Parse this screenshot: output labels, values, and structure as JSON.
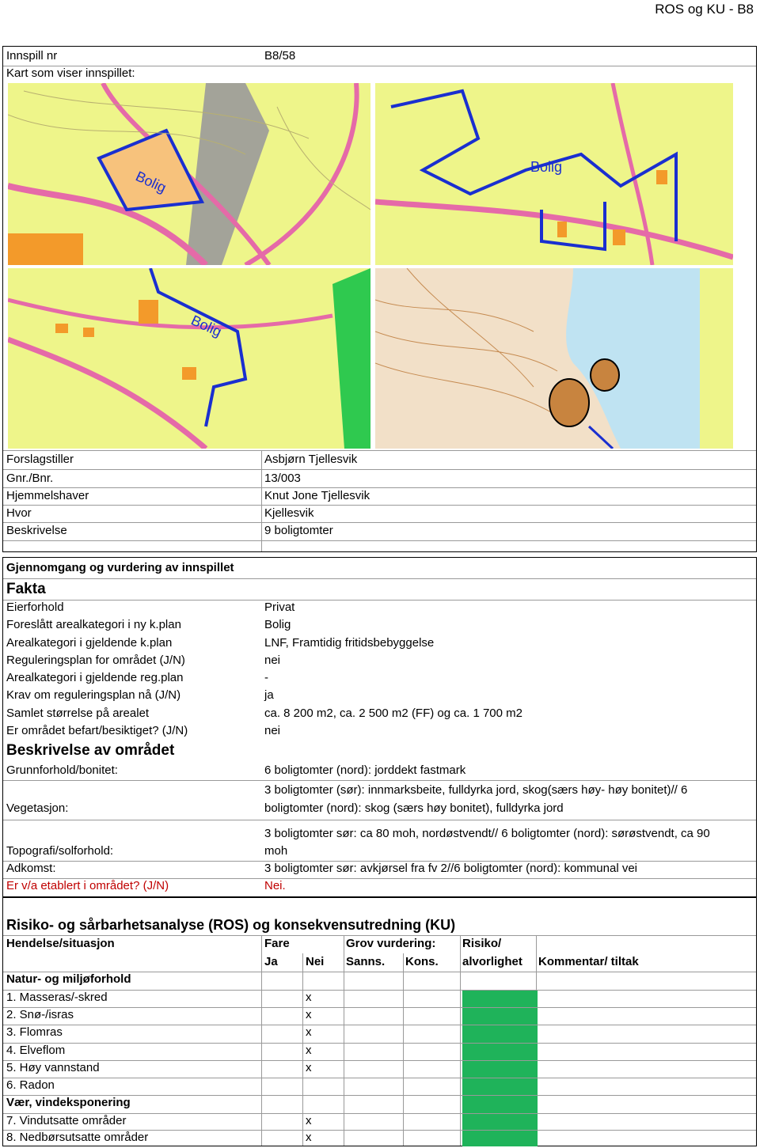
{
  "header": {
    "title": "ROS og KU - B8"
  },
  "top": {
    "innspill_label": "Innspill nr",
    "innspill_value": "B8/58",
    "map_label": "Kart som viser innspillet:"
  },
  "maps": {
    "label": "Bolig"
  },
  "info": [
    {
      "label": "Forslagstiller",
      "value": "Asbjørn Tjellesvik"
    },
    {
      "label": "Gnr./Bnr.",
      "value": "13/003"
    },
    {
      "label": "Hjemmelshaver",
      "value": "Knut Jone Tjellesvik"
    },
    {
      "label": "Hvor",
      "value": "Kjellesvik"
    },
    {
      "label": "Beskrivelse",
      "value": "9 boligtomter"
    }
  ],
  "review": {
    "heading": "Gjennomgang og vurdering av innspillet",
    "fakta": "Fakta",
    "rows": [
      {
        "label": "Eierforhold",
        "value": "Privat"
      },
      {
        "label": "Foreslått arealkategori i ny k.plan",
        "value": "Bolig"
      },
      {
        "label": "Arealkategori i gjeldende k.plan",
        "value": "LNF, Framtidig fritidsbebyggelse"
      },
      {
        "label": "Reguleringsplan for området (J/N)",
        "value": "nei"
      },
      {
        "label": "Arealkategori i gjeldende reg.plan",
        "value": "-"
      },
      {
        "label": "Krav om reguleringsplan nå (J/N)",
        "value": "ja"
      },
      {
        "label": "Samlet størrelse på arealet",
        "value": "ca. 8 200 m2, ca. 2 500 m2 (FF) og ca. 1 700 m2"
      },
      {
        "label": "Er området befart/besiktiget? (J/N)",
        "value": "nei"
      }
    ],
    "beskrivelse_heading": "Beskrivelse av området",
    "grunn_label": "Grunnforhold/bonitet:",
    "grunn_value": "6 boligtomter (nord): jorddekt fastmark",
    "veg_label": "Vegetasjon:",
    "veg_value1": "3 boligtomter (sør): innmarksbeite, fulldyrka jord, skog(særs høy- høy bonitet)// 6",
    "veg_value2": "boligtomter (nord): skog (særs høy bonitet), fulldyrka jord",
    "topo_label": "Topografi/solforhold:",
    "topo_value1": "3 boligtomter sør: ca 80 moh, nordøstvendt// 6 boligtomter (nord): sørøstvendt, ca 90",
    "topo_value2": "moh",
    "adkomst_label": "Adkomst:",
    "adkomst_value": "3 boligtomter sør: avkjørsel fra fv 2//6 boligtomter (nord): kommunal vei",
    "etablert_label": "Er v/a etablert i området? (J/N)",
    "etablert_value": "Nei."
  },
  "ros": {
    "heading": "Risiko- og sårbarhetsanalyse (ROS) og konsekvensutredning (KU)",
    "col_hendelse": "Hendelse/situasjon",
    "col_fare": "Fare",
    "col_grov": "Grov vurdering:",
    "col_risiko": "Risiko/",
    "col_ja": "Ja",
    "col_nei": "Nei",
    "col_sanns": "Sanns.",
    "col_kons": "Kons.",
    "col_alvorlighet": "alvorlighet",
    "col_kommentar": "Kommentar/ tiltak",
    "section1": "Natur- og miljøforhold",
    "section2": "Vær, vindeksponering",
    "rows": [
      {
        "label": "1. Masseras/-skred",
        "nei": "x",
        "risk": "green"
      },
      {
        "label": "2. Snø-/isras",
        "nei": "x",
        "risk": "green"
      },
      {
        "label": "3. Flomras",
        "nei": "x",
        "risk": "green"
      },
      {
        "label": "4. Elveflom",
        "nei": "x",
        "risk": "green"
      },
      {
        "label": "5. Høy vannstand",
        "nei": "x",
        "risk": "green"
      },
      {
        "label": "6. Radon",
        "nei": "",
        "risk": "green"
      },
      {
        "label": "7. Vindutsatte områder",
        "nei": "x",
        "risk": "green"
      },
      {
        "label": "8. Nedbørsutsatte områder",
        "nei": "x",
        "risk": "green"
      }
    ],
    "risk_color": "#1fb35a"
  }
}
